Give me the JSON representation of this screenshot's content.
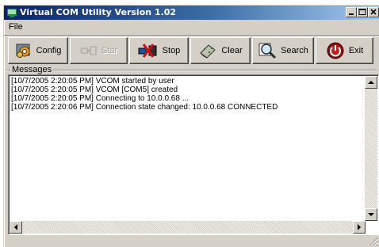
{
  "window": {
    "title": "Virtual COM Utility Version 1.02"
  },
  "menu": {
    "file": "File"
  },
  "toolbar": {
    "config": "Config",
    "start": "Star",
    "stop": "Stop",
    "clear": "Clear",
    "search": "Search",
    "exit": "Exit"
  },
  "messages": {
    "label": "Messages",
    "lines": [
      "[10/7/2005 2:20:05 PM]  VCOM  started by user",
      "[10/7/2005 2:20:05 PM]  VCOM  [COM5]  created",
      "[10/7/2005 2:20:05 PM]  Connecting to 10.0.0.68 ...",
      "[10/7/2005 2:20:06 PM]  Connection state changed: 10.0.0.68 CONNECTED"
    ]
  },
  "icons": {
    "app": "network-app-icon",
    "config": "gear-icon",
    "start": "connect-plug-icon",
    "stop": "disconnect-plug-icon",
    "clear": "eraser-icon",
    "search": "magnifier-icon",
    "exit": "power-icon"
  }
}
